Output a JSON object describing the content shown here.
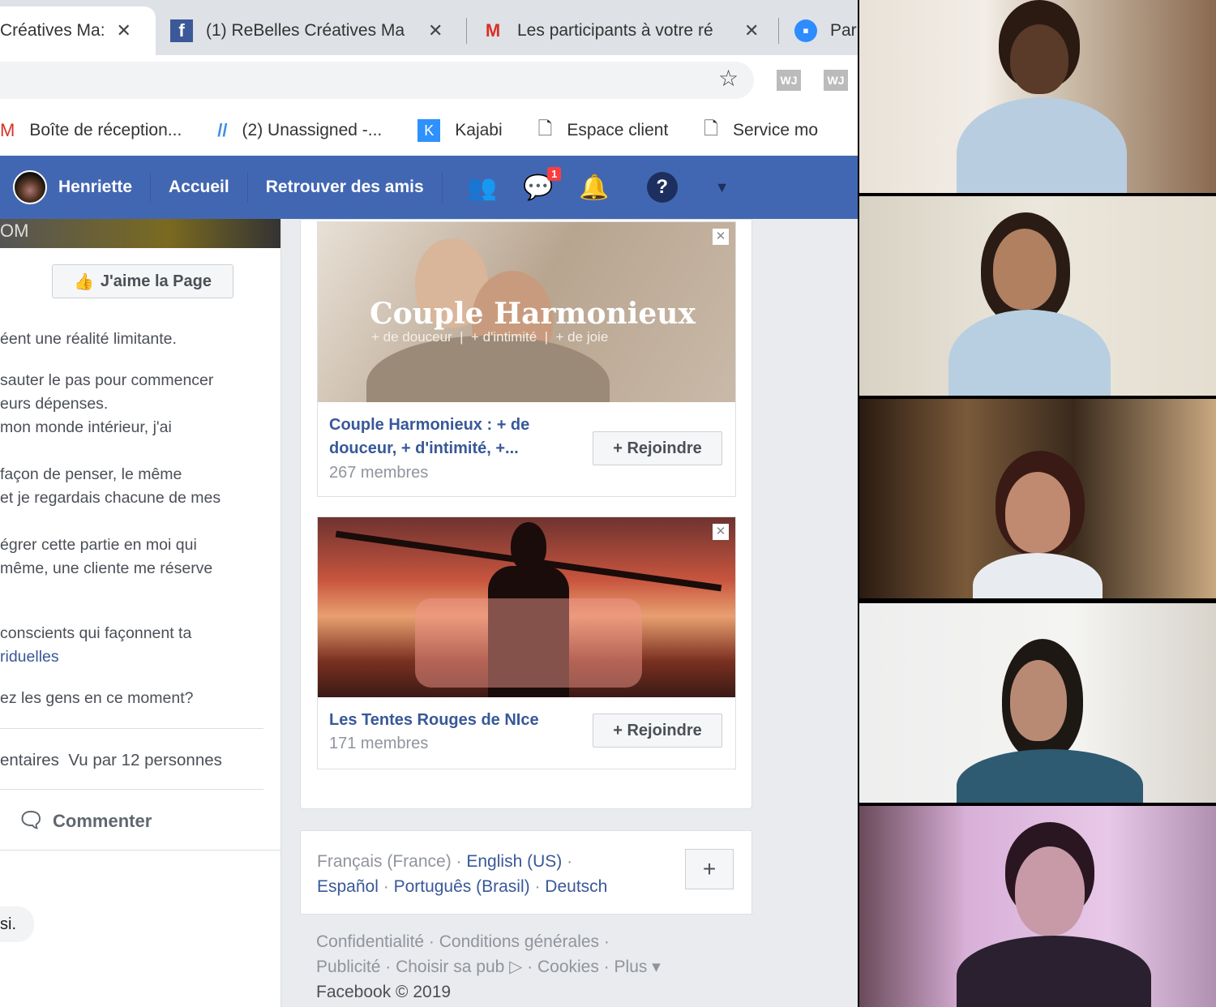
{
  "browser": {
    "tabs": [
      {
        "title": "Créatives Ma:",
        "icon": "tab-icon",
        "close": "✕",
        "active": true
      },
      {
        "title": "(1) ReBelles Créatives Ma",
        "icon": "facebook-icon",
        "close": "✕"
      },
      {
        "title": "Les participants à votre ré",
        "icon": "gmail-icon",
        "close": "✕"
      },
      {
        "title": "Par",
        "icon": "zoom-icon"
      }
    ],
    "extensions": [
      "WJ",
      "WJ"
    ],
    "bookmarks": [
      {
        "label": "Boîte de réception...",
        "icon": "gmail-icon"
      },
      {
        "label": "(2) Unassigned -...",
        "icon": "slashes-icon"
      },
      {
        "label": "Kajabi",
        "icon": "kajabi-icon"
      },
      {
        "label": "Espace client",
        "icon": "page-icon"
      },
      {
        "label": "Service mo",
        "icon": "page-icon"
      }
    ]
  },
  "facebook": {
    "nav": {
      "user": "Henriette",
      "home": "Accueil",
      "find_friends": "Retrouver des amis",
      "messenger_badge": "1"
    },
    "left": {
      "cover_text": "OM",
      "like_page": "J'aime la Page",
      "lines": [
        "éent une réalité limitante.",
        "sauter le pas pour commencer",
        "eurs dépenses.",
        "mon monde intérieur, j'ai",
        "façon de penser, le même",
        "et je regardais chacune de mes",
        "égrer cette partie en moi qui",
        "même, une cliente me réserve",
        "conscients qui façonnent ta"
      ],
      "link_line": "riduelles",
      "question": "ez les gens en ce moment?",
      "stats": "entaires  Vu par 12 personnes",
      "comment": "Commenter",
      "reply": "si."
    },
    "groups": [
      {
        "title_line1": "Couple Harmonieux : + de",
        "title_line2": "douceur, + d'intimité, +...",
        "members": "267 membres",
        "image_title": "Couple Harmonieux",
        "image_sub": "+ de douceur  |  + d'intimité  |  + de joie",
        "join": "+ Rejoindre"
      },
      {
        "title_line1": "Les Tentes Rouges de NIce",
        "members": "171 membres",
        "join": "+ Rejoindre"
      }
    ],
    "languages": {
      "current": "Français (France)",
      "others": [
        "English (US)",
        "Español",
        "Português (Brasil)",
        "Deutsch"
      ],
      "add": "+"
    },
    "footer": {
      "links1": [
        "Confidentialité",
        "Conditions générales"
      ],
      "links2": [
        "Publicité",
        "Choisir sa pub",
        "Cookies",
        "Plus"
      ],
      "copyright": "Facebook © 2019"
    }
  },
  "participants": 5
}
